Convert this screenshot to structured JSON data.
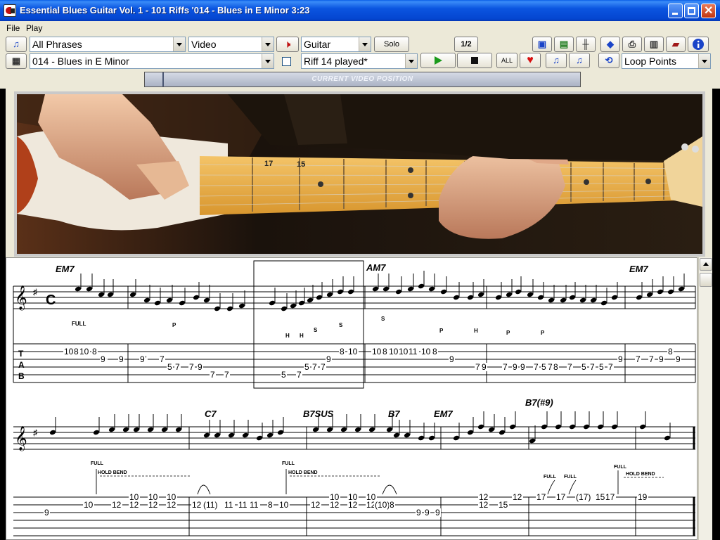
{
  "window": {
    "title": "Essential Blues Guitar Vol. 1 - 101 Riffs '014 - Blues in E Minor 3:23"
  },
  "menu": {
    "items": [
      "File",
      "Play"
    ]
  },
  "toolbar": {
    "phrase_filter": "All Phrases",
    "view_mode": "Video",
    "instrument": "Guitar",
    "solo_label": "Solo",
    "speed_label": "1/2",
    "song": "014 - Blues in E Minor",
    "riff_status": "Riff 14 played*",
    "all_label": "ALL",
    "loop_mode": "Loop Points",
    "colors": {
      "play": "#1a9a1a",
      "heart": "#d81010",
      "info": "#1a44c8"
    }
  },
  "position_bar": {
    "label": "CURRENT VIDEO POSITION"
  },
  "video": {
    "fret_markers": [
      "17",
      "15"
    ]
  },
  "notation": {
    "system1": {
      "chords": [
        "EM7",
        "AM7",
        "EM7"
      ],
      "annotations": [
        "FULL",
        "P",
        "H",
        "H",
        "S",
        "S",
        "S",
        "P",
        "H",
        "P",
        "P"
      ],
      "tab_numbers": [
        "10",
        "8",
        "10",
        "8",
        "9",
        "9",
        "9",
        "7",
        "9",
        "7",
        "5",
        "7",
        "7",
        "9",
        "7",
        "7",
        "5",
        "7",
        "5",
        "7",
        "7",
        "9",
        "8",
        "10",
        "10",
        "8",
        "10",
        "10",
        "11",
        "10",
        "8",
        "9",
        "7",
        "9",
        "7",
        "9",
        "9",
        "7",
        "5",
        "7",
        "8",
        "7",
        "5",
        "7",
        "5",
        "7",
        "9",
        "7",
        "7",
        "9",
        "8",
        "9"
      ]
    },
    "system2": {
      "chords": [
        "C7",
        "B7SUS",
        "B7",
        "EM7",
        "B7(#9)"
      ],
      "annotations": [
        "FULL",
        "HOLD BEND",
        "FULL",
        "HOLD BEND",
        "FULL",
        "FULL",
        "FULL",
        "HOLD BEND"
      ],
      "tab_numbers": [
        "9",
        "10",
        "12",
        "10",
        "12",
        "10",
        "12",
        "10",
        "12",
        "12",
        "(11)",
        "11",
        "11",
        "11",
        "8",
        "10",
        "12",
        "10",
        "12",
        "10",
        "12",
        "10",
        "12",
        "(10)",
        "8",
        "9",
        "9",
        "9",
        "12",
        "12",
        "15",
        "12",
        "17",
        "17",
        "(17)",
        "15",
        "17",
        "19"
      ]
    }
  }
}
